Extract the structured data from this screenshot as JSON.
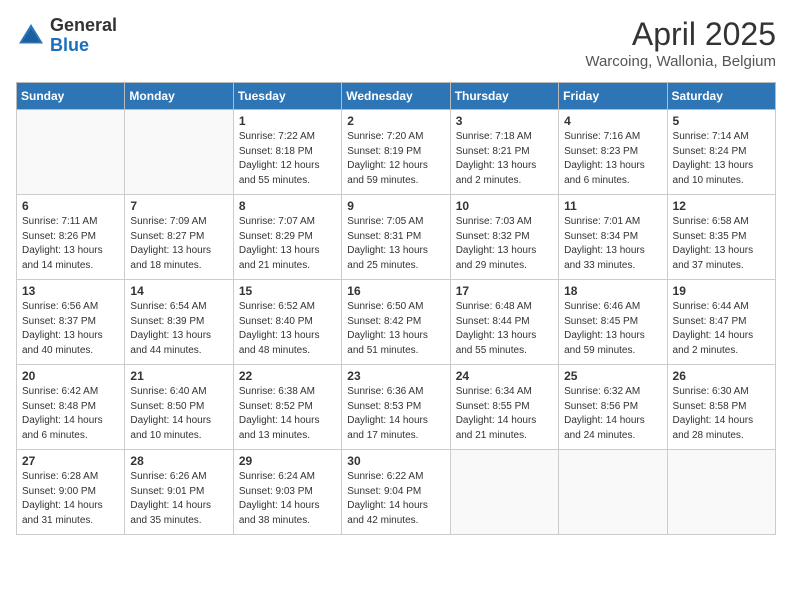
{
  "header": {
    "logo_general": "General",
    "logo_blue": "Blue",
    "month_year": "April 2025",
    "location": "Warcoing, Wallonia, Belgium"
  },
  "days_of_week": [
    "Sunday",
    "Monday",
    "Tuesday",
    "Wednesday",
    "Thursday",
    "Friday",
    "Saturday"
  ],
  "weeks": [
    [
      {
        "day": "",
        "info": ""
      },
      {
        "day": "",
        "info": ""
      },
      {
        "day": "1",
        "info": "Sunrise: 7:22 AM\nSunset: 8:18 PM\nDaylight: 12 hours\nand 55 minutes."
      },
      {
        "day": "2",
        "info": "Sunrise: 7:20 AM\nSunset: 8:19 PM\nDaylight: 12 hours\nand 59 minutes."
      },
      {
        "day": "3",
        "info": "Sunrise: 7:18 AM\nSunset: 8:21 PM\nDaylight: 13 hours\nand 2 minutes."
      },
      {
        "day": "4",
        "info": "Sunrise: 7:16 AM\nSunset: 8:23 PM\nDaylight: 13 hours\nand 6 minutes."
      },
      {
        "day": "5",
        "info": "Sunrise: 7:14 AM\nSunset: 8:24 PM\nDaylight: 13 hours\nand 10 minutes."
      }
    ],
    [
      {
        "day": "6",
        "info": "Sunrise: 7:11 AM\nSunset: 8:26 PM\nDaylight: 13 hours\nand 14 minutes."
      },
      {
        "day": "7",
        "info": "Sunrise: 7:09 AM\nSunset: 8:27 PM\nDaylight: 13 hours\nand 18 minutes."
      },
      {
        "day": "8",
        "info": "Sunrise: 7:07 AM\nSunset: 8:29 PM\nDaylight: 13 hours\nand 21 minutes."
      },
      {
        "day": "9",
        "info": "Sunrise: 7:05 AM\nSunset: 8:31 PM\nDaylight: 13 hours\nand 25 minutes."
      },
      {
        "day": "10",
        "info": "Sunrise: 7:03 AM\nSunset: 8:32 PM\nDaylight: 13 hours\nand 29 minutes."
      },
      {
        "day": "11",
        "info": "Sunrise: 7:01 AM\nSunset: 8:34 PM\nDaylight: 13 hours\nand 33 minutes."
      },
      {
        "day": "12",
        "info": "Sunrise: 6:58 AM\nSunset: 8:35 PM\nDaylight: 13 hours\nand 37 minutes."
      }
    ],
    [
      {
        "day": "13",
        "info": "Sunrise: 6:56 AM\nSunset: 8:37 PM\nDaylight: 13 hours\nand 40 minutes."
      },
      {
        "day": "14",
        "info": "Sunrise: 6:54 AM\nSunset: 8:39 PM\nDaylight: 13 hours\nand 44 minutes."
      },
      {
        "day": "15",
        "info": "Sunrise: 6:52 AM\nSunset: 8:40 PM\nDaylight: 13 hours\nand 48 minutes."
      },
      {
        "day": "16",
        "info": "Sunrise: 6:50 AM\nSunset: 8:42 PM\nDaylight: 13 hours\nand 51 minutes."
      },
      {
        "day": "17",
        "info": "Sunrise: 6:48 AM\nSunset: 8:44 PM\nDaylight: 13 hours\nand 55 minutes."
      },
      {
        "day": "18",
        "info": "Sunrise: 6:46 AM\nSunset: 8:45 PM\nDaylight: 13 hours\nand 59 minutes."
      },
      {
        "day": "19",
        "info": "Sunrise: 6:44 AM\nSunset: 8:47 PM\nDaylight: 14 hours\nand 2 minutes."
      }
    ],
    [
      {
        "day": "20",
        "info": "Sunrise: 6:42 AM\nSunset: 8:48 PM\nDaylight: 14 hours\nand 6 minutes."
      },
      {
        "day": "21",
        "info": "Sunrise: 6:40 AM\nSunset: 8:50 PM\nDaylight: 14 hours\nand 10 minutes."
      },
      {
        "day": "22",
        "info": "Sunrise: 6:38 AM\nSunset: 8:52 PM\nDaylight: 14 hours\nand 13 minutes."
      },
      {
        "day": "23",
        "info": "Sunrise: 6:36 AM\nSunset: 8:53 PM\nDaylight: 14 hours\nand 17 minutes."
      },
      {
        "day": "24",
        "info": "Sunrise: 6:34 AM\nSunset: 8:55 PM\nDaylight: 14 hours\nand 21 minutes."
      },
      {
        "day": "25",
        "info": "Sunrise: 6:32 AM\nSunset: 8:56 PM\nDaylight: 14 hours\nand 24 minutes."
      },
      {
        "day": "26",
        "info": "Sunrise: 6:30 AM\nSunset: 8:58 PM\nDaylight: 14 hours\nand 28 minutes."
      }
    ],
    [
      {
        "day": "27",
        "info": "Sunrise: 6:28 AM\nSunset: 9:00 PM\nDaylight: 14 hours\nand 31 minutes."
      },
      {
        "day": "28",
        "info": "Sunrise: 6:26 AM\nSunset: 9:01 PM\nDaylight: 14 hours\nand 35 minutes."
      },
      {
        "day": "29",
        "info": "Sunrise: 6:24 AM\nSunset: 9:03 PM\nDaylight: 14 hours\nand 38 minutes."
      },
      {
        "day": "30",
        "info": "Sunrise: 6:22 AM\nSunset: 9:04 PM\nDaylight: 14 hours\nand 42 minutes."
      },
      {
        "day": "",
        "info": ""
      },
      {
        "day": "",
        "info": ""
      },
      {
        "day": "",
        "info": ""
      }
    ]
  ]
}
